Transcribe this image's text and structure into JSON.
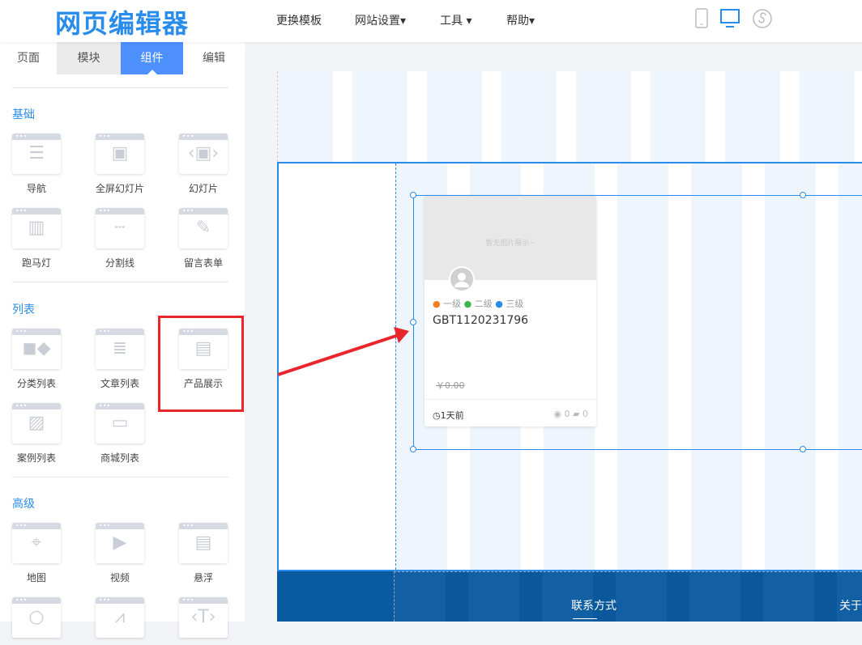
{
  "header": {
    "logo": "网页编辑器",
    "nav": [
      "更换模板",
      "网站设置▾",
      "工具 ▾",
      "帮助▾"
    ],
    "devices": [
      "mobile-icon",
      "desktop-icon",
      "mini-program-icon"
    ]
  },
  "sidebar": {
    "tabs": [
      "页面",
      "模块",
      "组件",
      "编辑"
    ],
    "active_tab": "组件",
    "sections": [
      {
        "title": "基础",
        "items": [
          {
            "label": "导航",
            "icon": "☰"
          },
          {
            "label": "全屏幻灯片",
            "icon": "▣"
          },
          {
            "label": "幻灯片",
            "icon": "‹▣›"
          },
          {
            "label": "跑马灯",
            "icon": "▥"
          },
          {
            "label": "分割线",
            "icon": "┄"
          },
          {
            "label": "留言表单",
            "icon": "✎"
          }
        ]
      },
      {
        "title": "列表",
        "items": [
          {
            "label": "分类列表",
            "icon": "◼◆"
          },
          {
            "label": "文章列表",
            "icon": "≣"
          },
          {
            "label": "产品展示",
            "icon": "▤"
          },
          {
            "label": "案例列表",
            "icon": "▨"
          },
          {
            "label": "商城列表",
            "icon": "▭"
          }
        ]
      },
      {
        "title": "高级",
        "items": [
          {
            "label": "地图",
            "icon": "⌖"
          },
          {
            "label": "视频",
            "icon": "▶"
          },
          {
            "label": "悬浮",
            "icon": "▤"
          },
          {
            "label": "",
            "icon": "○"
          },
          {
            "label": "",
            "icon": "⩘"
          },
          {
            "label": "",
            "icon": "‹T›"
          }
        ]
      }
    ]
  },
  "card": {
    "placeholder": "暂无图片展示~",
    "tags": [
      {
        "label": "一级",
        "color": "#f57c1f"
      },
      {
        "label": "二级",
        "color": "#3cb54a"
      },
      {
        "label": "三级",
        "color": "#2a8cea"
      }
    ],
    "title": "GBT1120231796",
    "price": "￥0.00",
    "time": "1天前",
    "views": "0",
    "comments": "0"
  },
  "footer": {
    "col1": "联系方式",
    "col2": "关于"
  },
  "colors": {
    "accent": "#2a8cea",
    "tab_active": "#4d90fe",
    "highlight": "#e8262b",
    "footer": "#0a5aa0"
  }
}
